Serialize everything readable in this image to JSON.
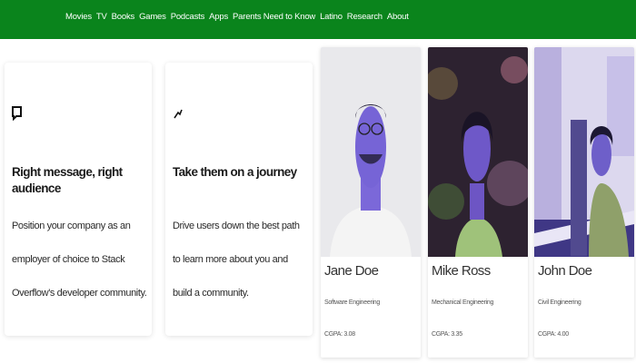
{
  "nav": [
    "Movies",
    "TV",
    "Books",
    "Games",
    "Podcasts",
    "Apps",
    "Parents Need to Know",
    "Latino",
    "Research",
    "About"
  ],
  "features": [
    {
      "icon": "chat-icon",
      "title": "Right message, right audience",
      "body": "Position your company as an employer of choice to Stack Overflow's developer community."
    },
    {
      "icon": "path-icon",
      "title": "Take them on a journey",
      "body": "Drive users down the best path to learn more about you and build a community."
    }
  ],
  "people": [
    {
      "name": "Jane Doe",
      "role": "Software Engineering",
      "gpa": "CGPA: 3.08"
    },
    {
      "name": "Mike Ross",
      "role": "Mechanical Engineering",
      "gpa": "CGPA: 3.35"
    },
    {
      "name": "John Doe",
      "role": "Civil Engineering",
      "gpa": "CGPA: 4.00"
    }
  ],
  "colors": {
    "header": "#0a841c",
    "photo_tint": "#6a5acd"
  }
}
